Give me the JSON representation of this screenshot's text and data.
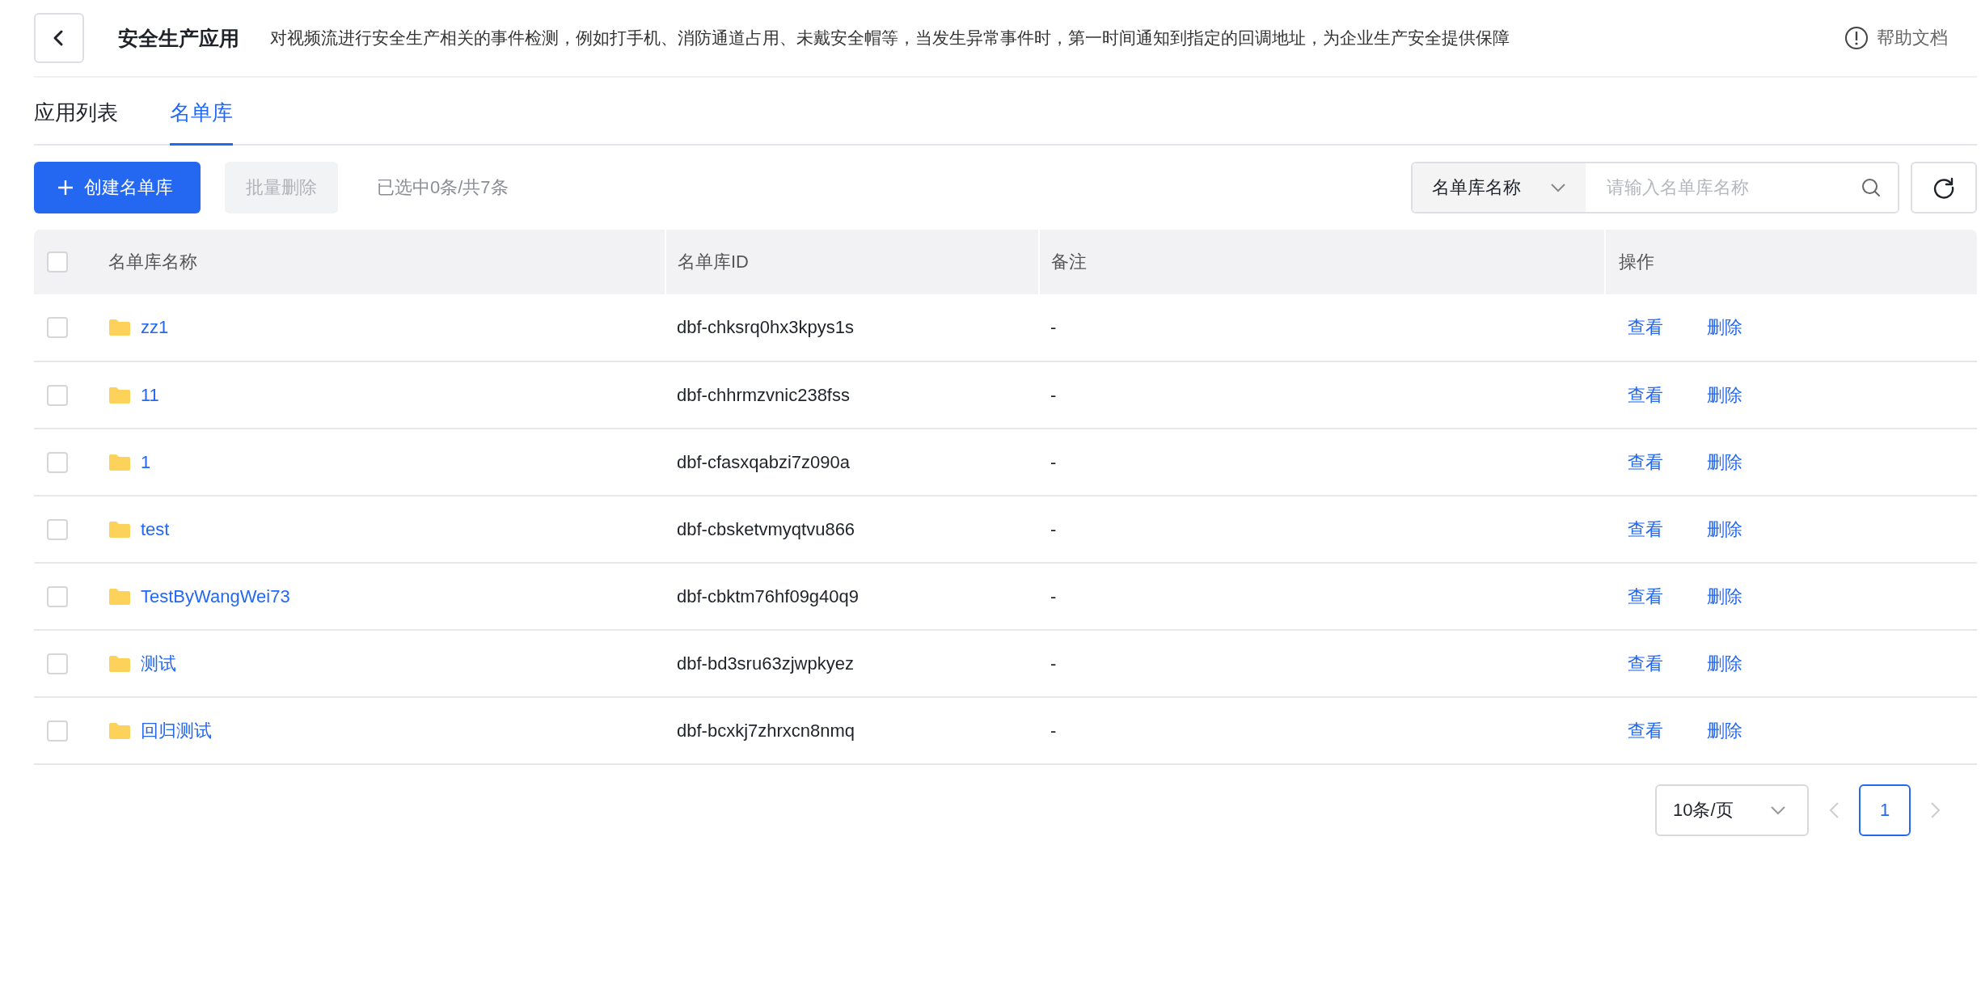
{
  "header": {
    "title": "安全生产应用",
    "description": "对视频流进行安全生产相关的事件检测，例如打手机、消防通道占用、未戴安全帽等，当发生异常事件时，第一时间通知到指定的回调地址，为企业生产安全提供保障",
    "help": "帮助文档"
  },
  "tabs": [
    {
      "label": "应用列表",
      "selected": false
    },
    {
      "label": "名单库",
      "selected": true
    }
  ],
  "toolbar": {
    "create_button": "创建名单库",
    "batch_delete": {
      "label": "批量删除",
      "disabled": true
    },
    "selection_summary": "已选中0条/共7条"
  },
  "search": {
    "filter_label": "名单库名称",
    "placeholder": "请输入名单库名称"
  },
  "table": {
    "select_all": {
      "checked": false
    },
    "columns": [
      "名单库名称",
      "名单库ID",
      "备注",
      "操作"
    ],
    "rows": [
      {
        "checked": false,
        "name": "zz1",
        "id": "dbf-chksrq0hx3kpys1s",
        "remark": "-",
        "actions": [
          "查看",
          "删除"
        ]
      },
      {
        "checked": false,
        "name": "11",
        "id": "dbf-chhrmzvnic238fss",
        "remark": "-",
        "actions": [
          "查看",
          "删除"
        ]
      },
      {
        "checked": false,
        "name": "1",
        "id": "dbf-cfasxqabzi7z090a",
        "remark": "-",
        "actions": [
          "查看",
          "删除"
        ]
      },
      {
        "checked": false,
        "name": "test",
        "id": "dbf-cbsketvmyqtvu866",
        "remark": "-",
        "actions": [
          "查看",
          "删除"
        ]
      },
      {
        "checked": false,
        "name": "TestByWangWei73",
        "id": "dbf-cbktm76hf09g40q9",
        "remark": "-",
        "actions": [
          "查看",
          "删除"
        ]
      },
      {
        "checked": false,
        "name": "测试",
        "id": "dbf-bd3sru63zjwpkyez",
        "remark": "-",
        "actions": [
          "查看",
          "删除"
        ]
      },
      {
        "checked": false,
        "name": "回归测试",
        "id": "dbf-bcxkj7zhrxcn8nmq",
        "remark": "-",
        "actions": [
          "查看",
          "删除"
        ]
      }
    ]
  },
  "pagination": {
    "page_size": "10条/页",
    "pages": [
      {
        "label": "1",
        "selected": true
      }
    ]
  }
}
